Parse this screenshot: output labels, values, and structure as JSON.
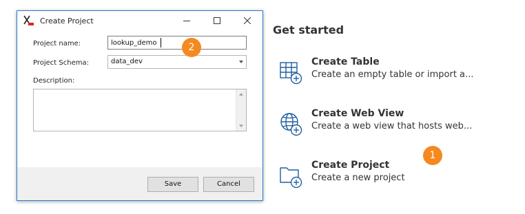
{
  "dialog": {
    "title": "Create Project",
    "fields": {
      "project_name_label": "Project name:",
      "project_name_value": "lookup_demo",
      "schema_label": "Project Schema:",
      "schema_value": "data_dev",
      "description_label": "Description:",
      "description_value": ""
    },
    "buttons": {
      "save": "Save",
      "cancel": "Cancel"
    }
  },
  "callouts": {
    "one": "1",
    "two": "2",
    "color": "#f5891f"
  },
  "get_started": {
    "heading": "Get started",
    "items": [
      {
        "title": "Create Table",
        "description": "Create an empty table or import a...",
        "icon": "table-add-icon"
      },
      {
        "title": "Create Web View",
        "description": "Create a web view that hosts web...",
        "icon": "globe-add-icon"
      },
      {
        "title": "Create Project",
        "description": "Create a new project",
        "icon": "folder-add-icon"
      }
    ]
  },
  "colors": {
    "accent_blue": "#2b79d0",
    "icon_blue": "#1f5e9e"
  }
}
